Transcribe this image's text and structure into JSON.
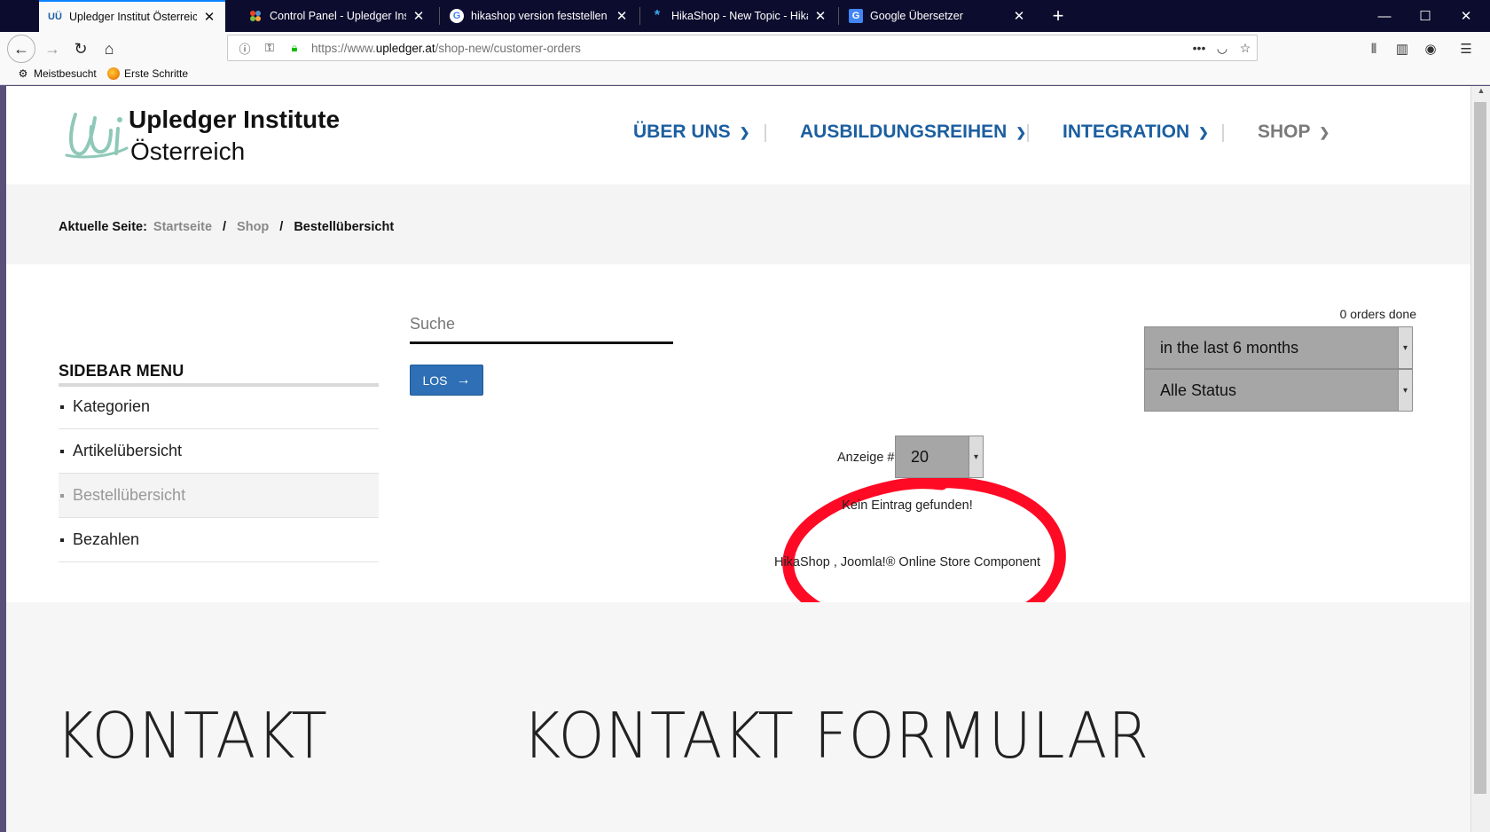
{
  "browser": {
    "tabs": [
      {
        "title": "Upledger Institut Österreich - B",
        "favicon": "UÜ",
        "active": true
      },
      {
        "title": "Control Panel - Upledger Institu",
        "favicon": "joomla-icon",
        "active": false
      },
      {
        "title": "hikashop version feststellen - G",
        "favicon": "G",
        "active": false
      },
      {
        "title": "HikaShop - New Topic - HikaSh",
        "favicon": "*",
        "active": false
      },
      {
        "title": "Google Übersetzer",
        "favicon": "G",
        "active": false
      }
    ],
    "url_prefix": "https://www.",
    "url_domain": "upledger.at",
    "url_path": "/shop-new/customer-orders",
    "bookmarks": [
      "Meistbesucht",
      "Erste Schritte"
    ]
  },
  "site": {
    "logo_line1": "Upledger Institute",
    "logo_line2": "Österreich",
    "nav": [
      "ÜBER UNS",
      "AUSBILDUNGSREIHEN",
      "INTEGRATION",
      "SHOP"
    ],
    "brand_color": "#1c5fa0"
  },
  "breadcrumb": {
    "label": "Aktuelle Seite:",
    "items": [
      "Startseite",
      "Shop"
    ],
    "current": "Bestellübersicht"
  },
  "sidebar": {
    "title": "SIDEBAR MENU",
    "items": [
      {
        "label": "Kategorien",
        "active": false
      },
      {
        "label": "Artikelübersicht",
        "active": false
      },
      {
        "label": "Bestellübersicht",
        "active": true
      },
      {
        "label": "Bezahlen",
        "active": false
      }
    ]
  },
  "search": {
    "placeholder": "Suche",
    "value": "",
    "button_label": "LOS"
  },
  "orders": {
    "count_text": "0 orders done",
    "period_filter": "in the last 6 months",
    "status_filter": "Alle Status",
    "display_label": "Anzeige #",
    "display_value": "20",
    "empty_message": "Kein Eintrag gefunden!",
    "credit": "HikaShop , Joomla!® Online Store Component"
  },
  "footer": {
    "contact_title": "KONTAKT",
    "contact_form_title": "KONTAKT FORMULAR"
  }
}
